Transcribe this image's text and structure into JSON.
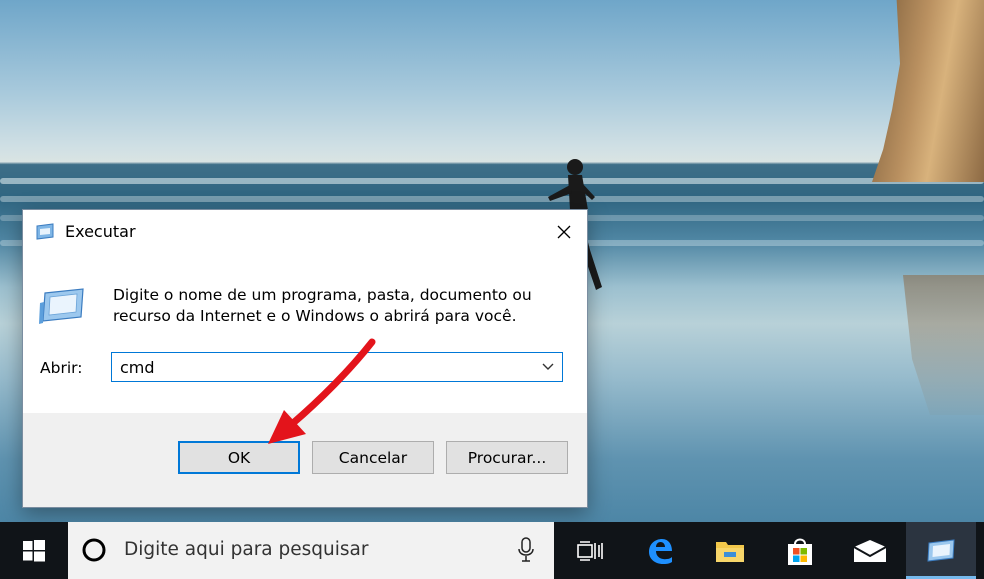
{
  "dialog": {
    "title": "Executar",
    "description": "Digite o nome de um programa, pasta, documento ou recurso da Internet e o Windows o abrirá para você.",
    "open_label": "Abrir:",
    "command_value": "cmd",
    "buttons": {
      "ok": "OK",
      "cancel": "Cancelar",
      "browse": "Procurar..."
    }
  },
  "taskbar": {
    "search_placeholder": "Digite aqui para pesquisar",
    "icons": [
      "windows-start-icon",
      "cortana-icon",
      "microphone-icon",
      "task-view-icon",
      "edge-icon",
      "file-explorer-icon",
      "store-icon",
      "mail-icon",
      "run-icon"
    ]
  },
  "colors": {
    "accent": "#0078d7",
    "annotation_arrow": "#e3141b",
    "taskbar": "#101418"
  }
}
